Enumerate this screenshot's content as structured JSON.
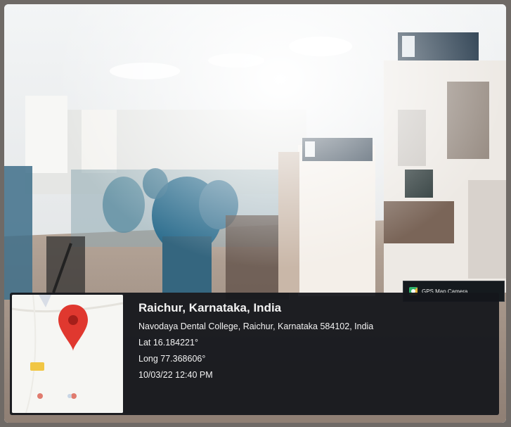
{
  "watermark": {
    "app_label": "GPS Map Camera",
    "icon": "gps-map-camera-icon"
  },
  "location": {
    "title": "Raichur, Karnataka, India",
    "address": "Navodaya Dental College, Raichur, Karnataka 584102, India",
    "latitude": "Lat 16.184221°",
    "longitude": "Long 77.368606°",
    "timestamp": "10/03/22 12:40 PM"
  },
  "map": {
    "pin_icon": "map-pin-icon",
    "pin_color": "#e0382f"
  },
  "colors": {
    "card_background": "#14161c",
    "scrubs": "#2f6f8f"
  }
}
